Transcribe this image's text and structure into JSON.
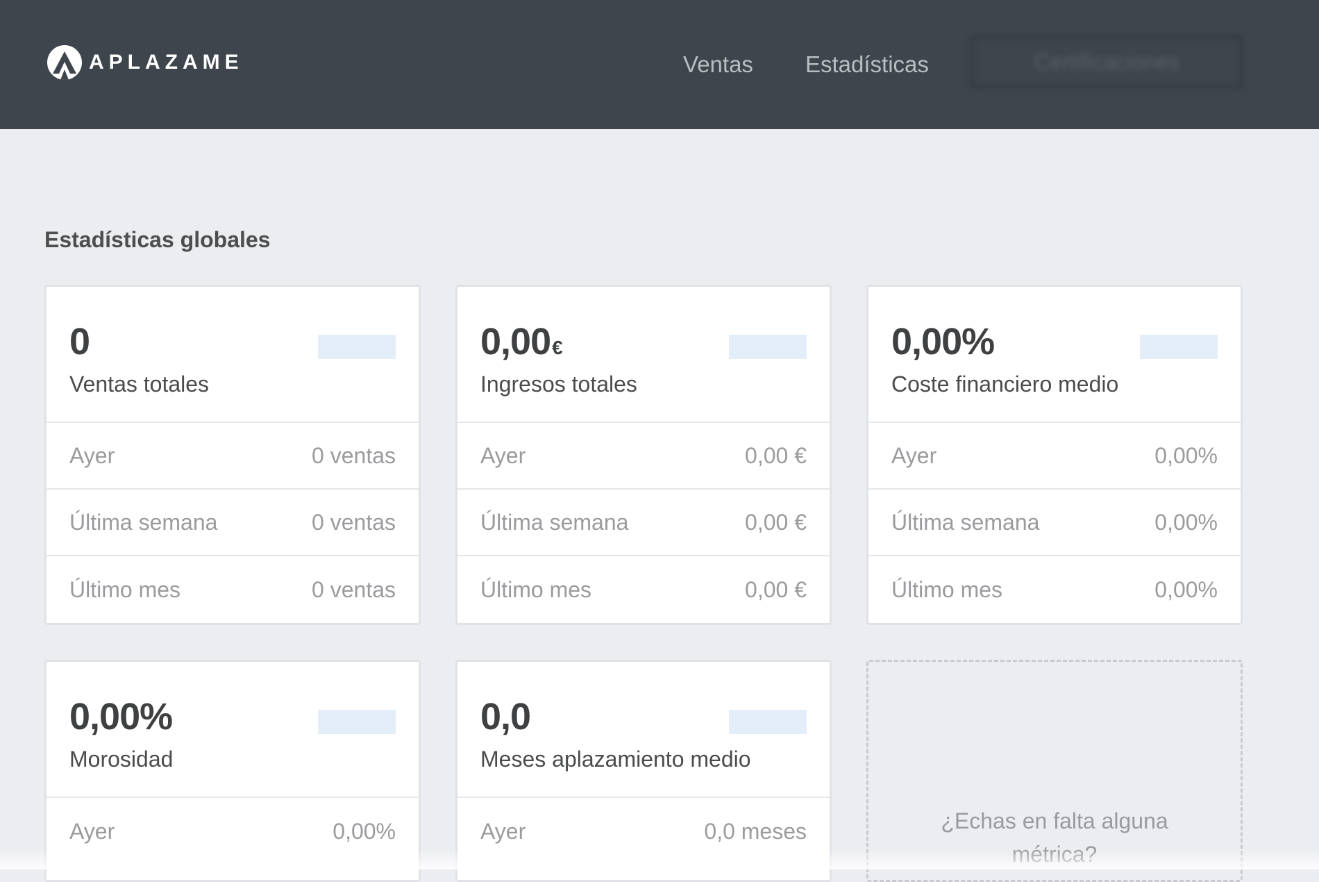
{
  "brand": {
    "name": "APLAZAME"
  },
  "nav": {
    "ventas": "Ventas",
    "estadisticas": "Estadísticas",
    "certificaciones": "Certificaciones"
  },
  "section": {
    "title": "Estadísticas globales"
  },
  "colors": {
    "topbar": "#3e454c",
    "background": "#ecedf0",
    "sparkline": "#e3eef9"
  },
  "cards": [
    {
      "value": "0",
      "unit": "",
      "label": "Ventas totales",
      "rows": [
        {
          "label": "Ayer",
          "value": "0 ventas"
        },
        {
          "label": "Última semana",
          "value": "0 ventas"
        },
        {
          "label": "Último mes",
          "value": "0 ventas"
        }
      ]
    },
    {
      "value": "0,00",
      "unit": "€",
      "label": "Ingresos totales",
      "rows": [
        {
          "label": "Ayer",
          "value": "0,00 €"
        },
        {
          "label": "Última semana",
          "value": "0,00 €"
        },
        {
          "label": "Último mes",
          "value": "0,00 €"
        }
      ]
    },
    {
      "value": "0,00%",
      "unit": "",
      "label": "Coste financiero medio",
      "rows": [
        {
          "label": "Ayer",
          "value": "0,00%"
        },
        {
          "label": "Última semana",
          "value": "0,00%"
        },
        {
          "label": "Último mes",
          "value": "0,00%"
        }
      ]
    },
    {
      "value": "0,00%",
      "unit": "",
      "label": "Morosidad",
      "rows": [
        {
          "label": "Ayer",
          "value": "0,00%"
        }
      ]
    },
    {
      "value": "0,0",
      "unit": "",
      "label": "Meses aplazamiento medio",
      "rows": [
        {
          "label": "Ayer",
          "value": "0,0 meses"
        }
      ]
    }
  ],
  "missing_metric": {
    "text": "¿Echas en falta alguna métrica?"
  }
}
